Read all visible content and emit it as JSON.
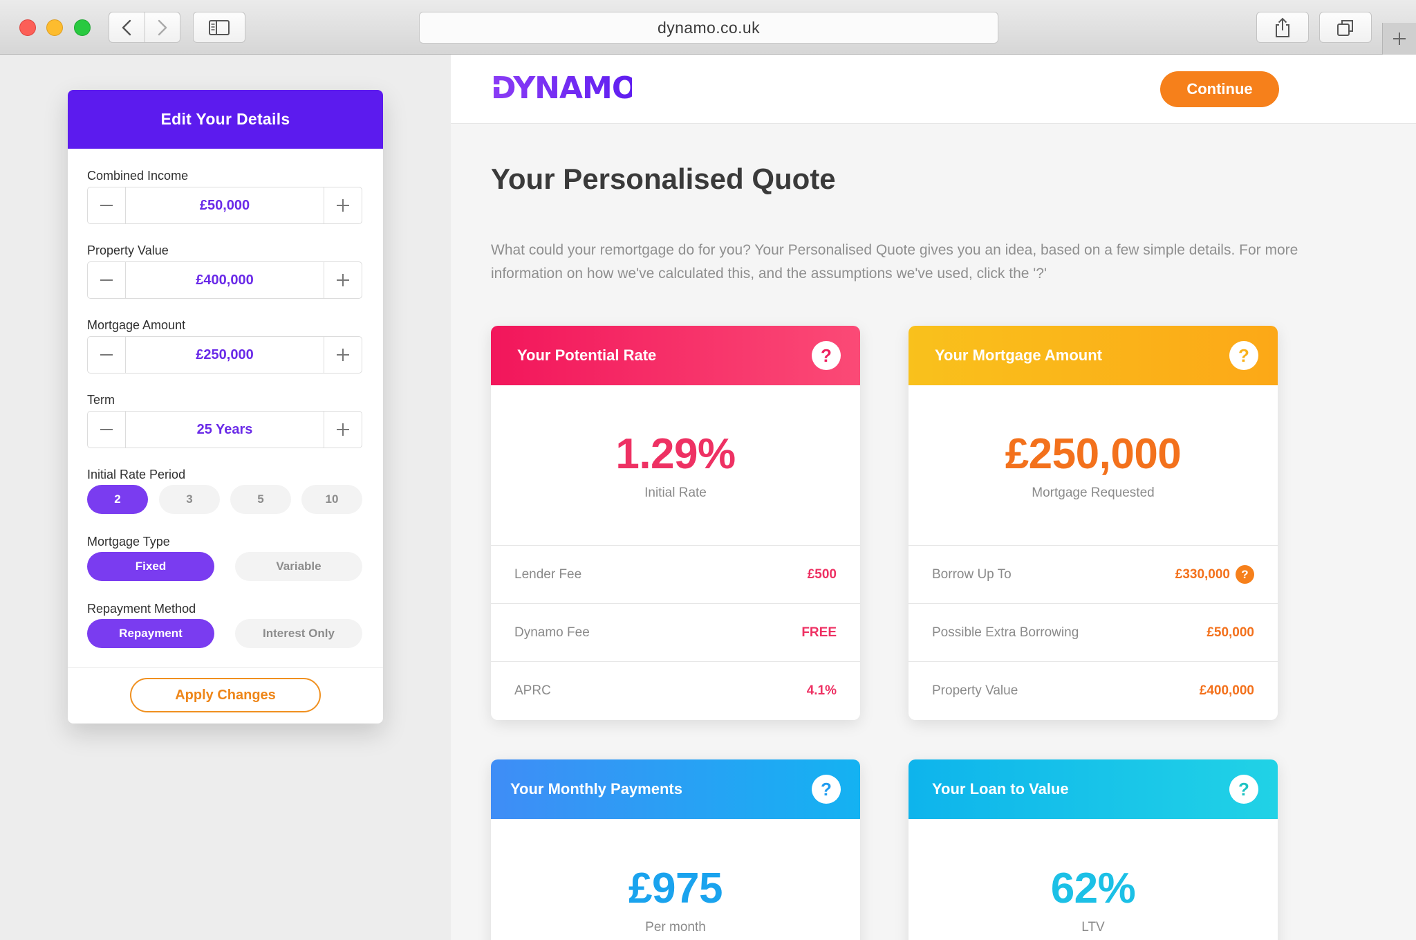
{
  "browser": {
    "url": "dynamo.co.uk"
  },
  "panel": {
    "title": "Edit Your Details",
    "fields": [
      {
        "label": "Combined Income",
        "value": "£50,000"
      },
      {
        "label": "Property Value",
        "value": "£400,000"
      },
      {
        "label": "Mortgage Amount",
        "value": "£250,000"
      },
      {
        "label": "Term",
        "value": "25 Years"
      }
    ],
    "rate_period": {
      "label": "Initial Rate Period",
      "options": [
        "2",
        "3",
        "5",
        "10"
      ],
      "selected": "2"
    },
    "mortgage_type": {
      "label": "Mortgage Type",
      "options": [
        "Fixed",
        "Variable"
      ],
      "selected": "Fixed"
    },
    "repayment_method": {
      "label": "Repayment Method",
      "options": [
        "Repayment",
        "Interest Only"
      ],
      "selected": "Repayment"
    },
    "apply_label": "Apply Changes"
  },
  "header": {
    "logo_text": "DYNAMO",
    "continue_label": "Continue"
  },
  "main": {
    "title": "Your Personalised Quote",
    "intro": "What could your remortgage do for you? Your Personalised Quote gives you an idea, based on a few simple details. For more information on how we've calculated this, and the assumptions we've used, click the '?'"
  },
  "cards": {
    "rate": {
      "title": "Your Potential Rate",
      "value": "1.29%",
      "caption": "Initial Rate",
      "rows": [
        {
          "label": "Lender Fee",
          "value": "£500"
        },
        {
          "label": "Dynamo Fee",
          "value": "FREE"
        },
        {
          "label": "APRC",
          "value": "4.1%"
        }
      ]
    },
    "amount": {
      "title": "Your Mortgage Amount",
      "value": "£250,000",
      "caption": "Mortgage Requested",
      "rows": [
        {
          "label": "Borrow Up To",
          "value": "£330,000"
        },
        {
          "label": "Possible Extra Borrowing",
          "value": "£50,000"
        },
        {
          "label": "Property Value",
          "value": "£400,000"
        }
      ]
    },
    "monthly": {
      "title": "Your Monthly Payments",
      "value": "£975",
      "caption": "Per month"
    },
    "ltv": {
      "title": "Your Loan to Value",
      "value": "62%",
      "caption": "LTV"
    }
  },
  "colors": {
    "brand_purple": "#5c1bee",
    "accent_orange": "#f6801b",
    "rate_pink": "#ee3163",
    "amount_orange": "#f3711c",
    "monthly_blue": "#1aa3ee",
    "ltv_cyan": "#1cc0e6"
  }
}
